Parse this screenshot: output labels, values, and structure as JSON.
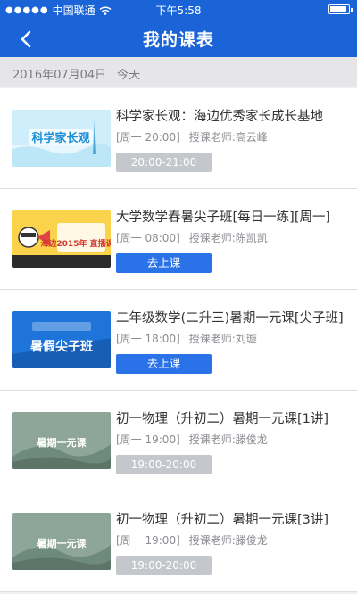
{
  "status": {
    "carrier": "中国联通",
    "time": "下午5:58"
  },
  "nav": {
    "title": "我的课表"
  },
  "date_bar": {
    "date": "2016年07月04日",
    "today": "今天"
  },
  "courses": [
    {
      "title": "科学家长观：海边优秀家长成长基地",
      "weekday_time": "[周一 20:00]",
      "teacher": "授课老师:高云峰",
      "action_type": "time",
      "action_label": "20:00-21:00",
      "thumb_text": "科学家长观",
      "thumb_icon": "science-parent-thumbnail-icon"
    },
    {
      "title": "大学数学春暑尖子班[每日一练][周一]",
      "weekday_time": "[周一 08:00]",
      "teacher": "授课老师:陈凯凯",
      "action_type": "button",
      "action_label": "去上课",
      "thumb_text": "海边2015年 直播课程",
      "thumb_icon": "live-course-thumbnail-icon"
    },
    {
      "title": "二年级数学(二升三)暑期一元课[尖子班]",
      "weekday_time": "[周一 18:00]",
      "teacher": "授课老师:刘璇",
      "action_type": "button",
      "action_label": "去上课",
      "thumb_text": "暑假尖子班",
      "thumb_icon": "summer-class-thumbnail-icon"
    },
    {
      "title": "初一物理（升初二）暑期一元课[1讲]",
      "weekday_time": "[周一 19:00]",
      "teacher": "授课老师:滕俊龙",
      "action_type": "time",
      "action_label": "19:00-20:00",
      "thumb_text": "暑期一元课",
      "thumb_icon": "physics-thumbnail-icon"
    },
    {
      "title": "初一物理（升初二）暑期一元课[3讲]",
      "weekday_time": "[周一 19:00]",
      "teacher": "授课老师:滕俊龙",
      "action_type": "time",
      "action_label": "19:00-20:00",
      "thumb_text": "暑期一元课",
      "thumb_icon": "physics-thumbnail-icon"
    }
  ],
  "colors": {
    "brand": "#1a64d8",
    "button": "#2a72e8",
    "time_badge": "#c4c8cc"
  }
}
